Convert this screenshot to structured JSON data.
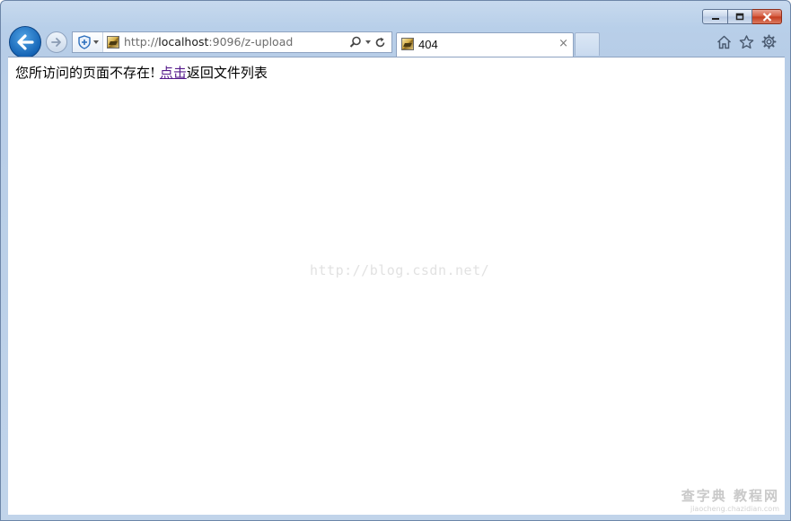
{
  "window": {
    "caption_buttons": {
      "minimize_icon": "minimize-icon",
      "maximize_icon": "restore-icon",
      "close_icon": "close-icon"
    }
  },
  "navigation": {
    "back_icon": "arrow-left-icon",
    "forward_icon": "arrow-right-icon"
  },
  "address_bar": {
    "url_prefix": "http://",
    "url_host": "localhost",
    "url_rest": ":9096/z-upload",
    "search_icon": "search-icon",
    "refresh_icon": "refresh-icon"
  },
  "tab": {
    "title": "404",
    "close": "×"
  },
  "toolbar": {
    "home_icon": "home-icon",
    "favorites_icon": "star-icon",
    "tools_icon": "gear-icon"
  },
  "page": {
    "message_before": "您所访问的页面不存在!",
    "link_text": "点击",
    "message_after": "返回文件列表",
    "watermark": "http://blog.csdn.net/",
    "corner_mark_big": "查字典 教程网",
    "corner_mark_small": "jiaocheng.chazidian.com"
  },
  "colors": {
    "back_button": "#1564b5",
    "link_visited": "#551a8b",
    "close_button": "#c33a1d"
  }
}
